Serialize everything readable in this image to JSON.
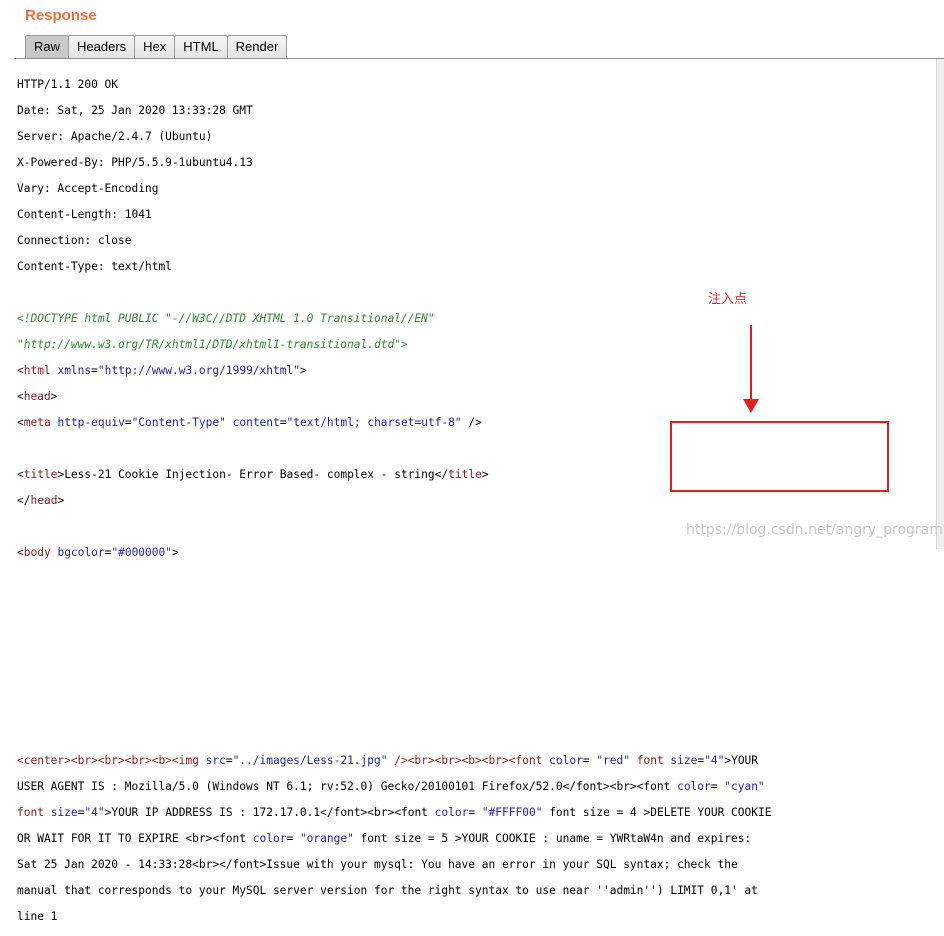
{
  "panel": {
    "title": "Response"
  },
  "tabs": [
    "Raw",
    "Headers",
    "Hex",
    "HTML",
    "Render"
  ],
  "headers": [
    "HTTP/1.1 200 OK",
    "Date: Sat, 25 Jan 2020 13:33:28 GMT",
    "Server: Apache/2.4.7 (Ubuntu)",
    "X-Powered-By: PHP/5.5.9-1ubuntu4.13",
    "Vary: Accept-Encoding",
    "Content-Length: 1041",
    "Connection: close",
    "Content-Type: text/html"
  ],
  "code": {
    "doctype_1": "<!DOCTYPE html PUBLIC \"-//W3C//DTD XHTML 1.0 Transitional//EN\"",
    "doctype_2": "\"http://www.w3.org/TR/xhtml1/DTD/xhtml1-transitional.dtd\">",
    "html_tag": "html",
    "xmlns_attr": "xmlns",
    "xmlns_val": "\"http://www.w3.org/1999/xhtml\"",
    "head_tag": "head",
    "meta_tag": "meta",
    "http_equiv_attr": "http-equiv",
    "http_equiv_val": "\"Content-Type\"",
    "content_attr": "content",
    "content_val": "\"text/html; charset=utf-8\"",
    "title_tag": "title",
    "title_text": "Less-21 Cookie Injection- Error Based- complex - string",
    "body_tag": "body",
    "bgcolor_attr": "bgcolor",
    "bgcolor_val": "\"#000000\"",
    "l1_a": "<center><br><br><br><b><img ",
    "l1_src_attr": "src",
    "l1_src_val": "\"../images/Less-21.jpg\"",
    "l1_b": " /><br><br><b><br><font ",
    "l1_color_attr": "color",
    "l1_color_val": "\"red\"",
    "l1_c": " font ",
    "l1_size_attr": "size",
    "l1_size_val": "\"4\"",
    "l1_d": ">YOUR",
    "l2_a": "USER AGENT IS : Mozilla/5.0 (Windows NT 6.1; rv:52.0) Gecko/20100101 Firefox/52.0</font><br><font ",
    "l2_color_attr": "color",
    "l2_color_val": "\"cyan\"",
    "l3_a": "font ",
    "l3_size_attr": "size",
    "l3_size_val": "\"4\"",
    "l3_b": ">YOUR IP ADDRESS IS : 172.17.0.1</font><br><font ",
    "l3_color_attr": "color",
    "l3_color_val": "\"#FFFF00\"",
    "l3_c": " font size = 4 >DELETE YOUR COOKIE",
    "l4_a": "OR WAIT FOR IT TO EXPIRE <br><font ",
    "l4_color_attr": "color",
    "l4_color_val": "\"orange\"",
    "l4_b": " font size = 5 >YOUR COOKIE : uname = YWRtaW4n and expires:",
    "l5": "Sat 25 Jan 2020 - 14:33:28<br></font>Issue with your mysql: You have an error in your SQL syntax; check the",
    "l6": "manual that corresponds to your MySQL server version for the right syntax to use near ''admin'') LIMIT 0,1' at",
    "l7": "line 1"
  },
  "annotation": {
    "label": "注入点",
    "color": "#e02020"
  },
  "watermark": "https://blog.csdn.net/angry_program"
}
